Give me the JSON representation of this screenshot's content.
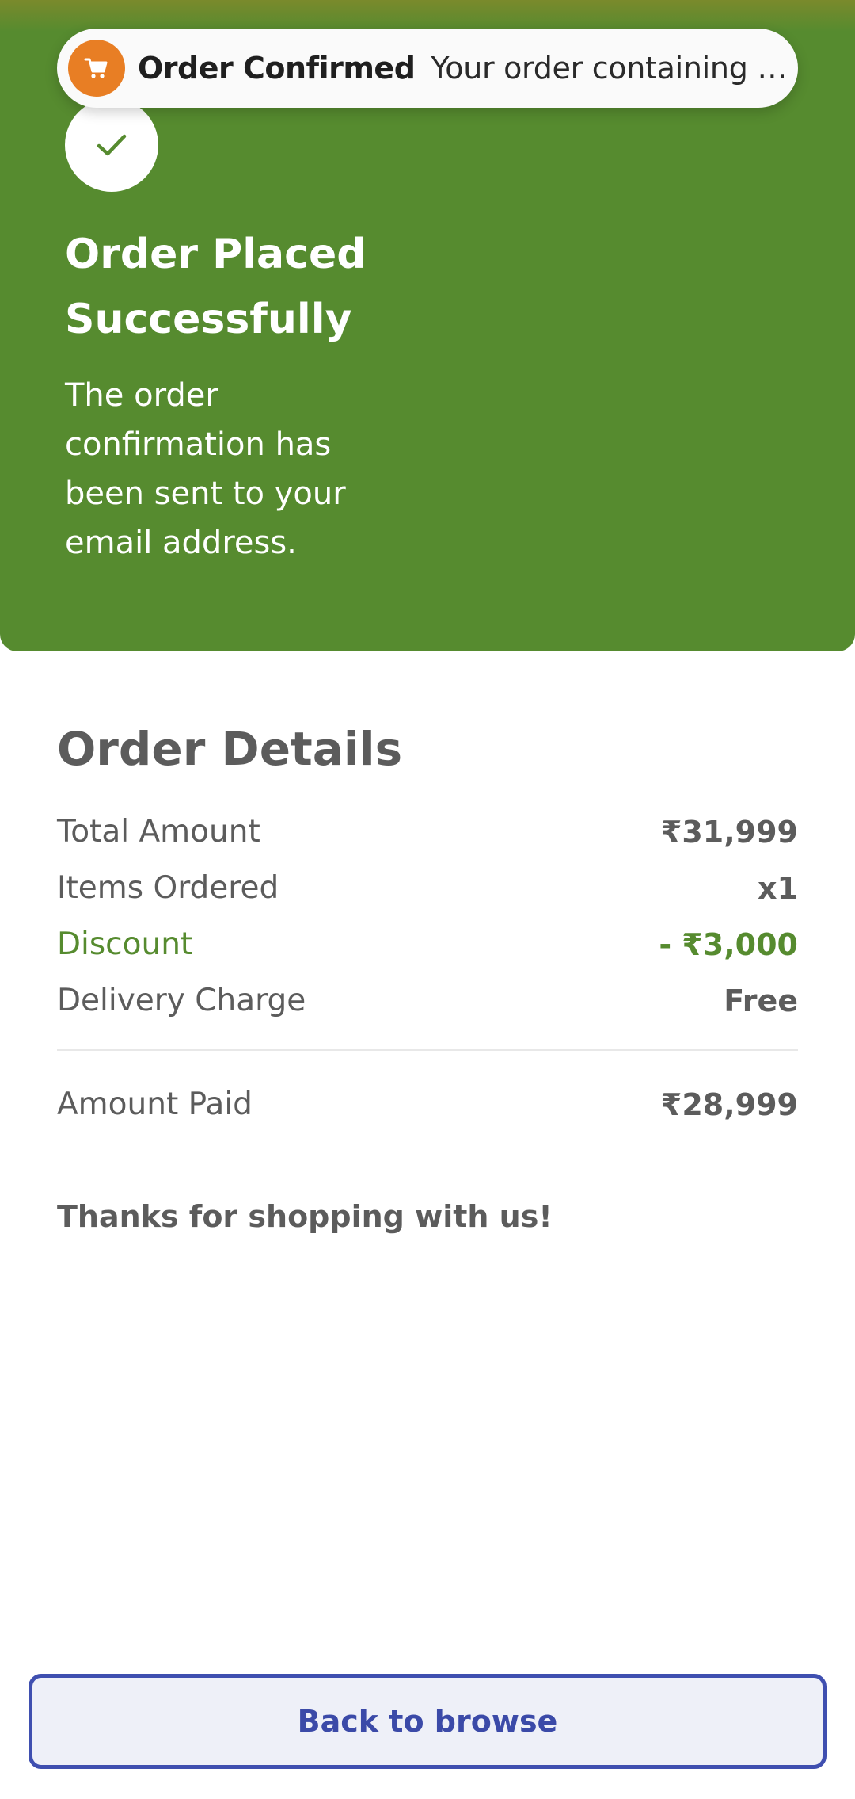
{
  "toast": {
    "icon": "shopping-cart-icon",
    "title": "Order Confirmed",
    "message": "Your order containing Go…"
  },
  "hero": {
    "icon": "checkmark-icon",
    "title": "Order Placed Successfully",
    "subtitle": "The order confirmation has been sent to your email address."
  },
  "details": {
    "title": "Order Details",
    "total_label": "Total Amount",
    "total_value": "₹31,999",
    "items_label": "Items Ordered",
    "items_value": "x1",
    "discount_label": "Discount",
    "discount_value": "- ₹3,000",
    "delivery_label": "Delivery Charge",
    "delivery_value": "Free",
    "paid_label": "Amount Paid",
    "paid_value": "₹28,999",
    "thanks": "Thanks for shopping with us!"
  },
  "actions": {
    "back_label": "Back to browse"
  },
  "colors": {
    "hero_green": "#568b2f",
    "discount_green": "#568b2f",
    "toast_icon_orange": "#e87e24",
    "button_blue": "#3f4fb0",
    "text_gray": "#5c5c5c"
  }
}
